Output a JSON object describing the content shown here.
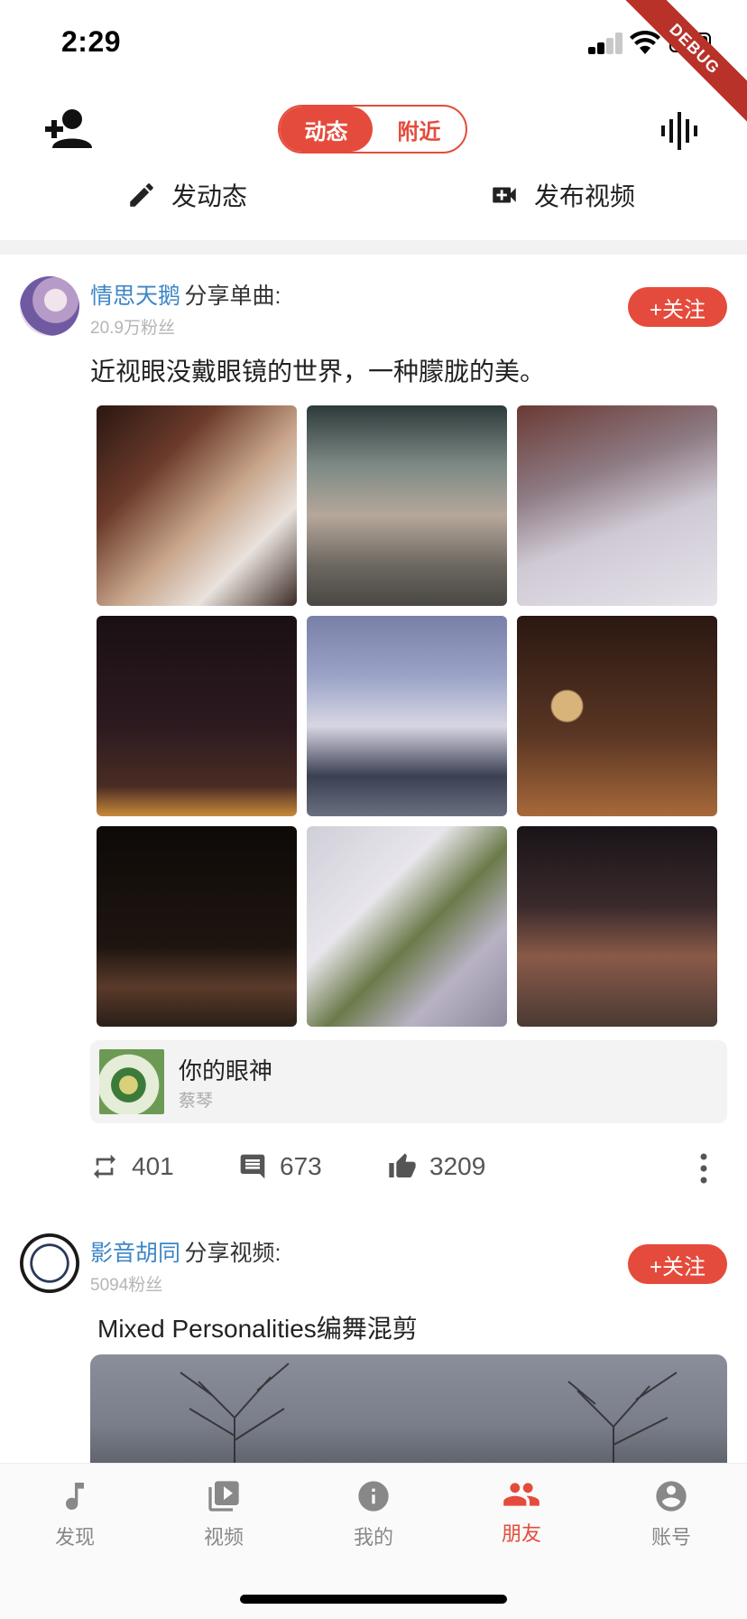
{
  "status_bar": {
    "time": "2:29"
  },
  "debug_banner": "DEBUG",
  "header": {
    "tabs": [
      {
        "label": "动态",
        "active": true
      },
      {
        "label": "附近",
        "active": false
      }
    ],
    "add_friend_icon": "person-add-icon",
    "voice_icon": "sound-wave-icon"
  },
  "actions": {
    "post_moment": "发动态",
    "post_video": "发布视频"
  },
  "posts": [
    {
      "username": "情思天鹅",
      "share_type": "分享单曲:",
      "fans": "20.9万粉丝",
      "follow_label": "+关注",
      "text": "近视眼没戴眼镜的世界，一种朦胧的美。",
      "photo_count": 9,
      "song": {
        "title": "你的眼神",
        "artist": "蔡琴"
      },
      "stats": {
        "reposts": "401",
        "comments": "673",
        "likes": "3209"
      }
    },
    {
      "username": "影音胡同",
      "share_type": "分享视频:",
      "fans": "5094粉丝",
      "follow_label": "+关注",
      "text": "Mixed Personalities编舞混剪"
    }
  ],
  "bottom_nav": [
    {
      "label": "发现",
      "icon": "music-note-icon",
      "active": false
    },
    {
      "label": "视频",
      "icon": "video-library-icon",
      "active": false
    },
    {
      "label": "我的",
      "icon": "info-icon",
      "active": false
    },
    {
      "label": "朋友",
      "icon": "people-icon",
      "active": true
    },
    {
      "label": "账号",
      "icon": "account-circle-icon",
      "active": false
    }
  ],
  "colors": {
    "accent": "#e54b3c",
    "link": "#3d86c6"
  }
}
